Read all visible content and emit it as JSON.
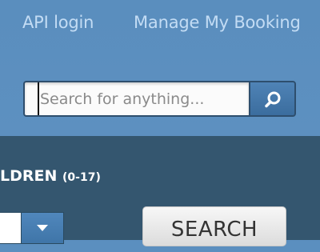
{
  "nav": {
    "api_login": "API login",
    "manage_booking": "Manage My Booking"
  },
  "search": {
    "placeholder": "Search for anything...",
    "button_icon": "search-icon"
  },
  "booking": {
    "children_label": "LDREN",
    "children_range": "(0-17)",
    "dropdown_icon": "chevron-down-icon",
    "search_button": "SEARCH"
  },
  "colors": {
    "header_bg": "#5b8fbf",
    "panel_bg": "#34566f",
    "link": "#c3dcf4",
    "button_blue": "#4779aa"
  }
}
